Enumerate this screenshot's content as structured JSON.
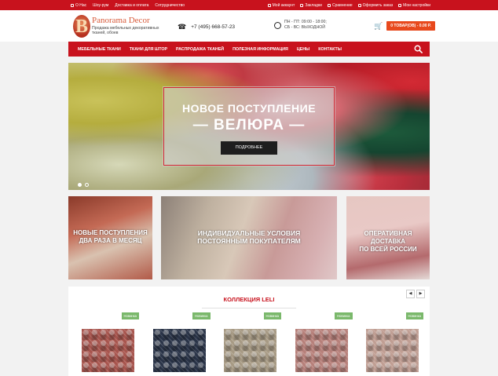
{
  "topbar": {
    "left": [
      "О Нас",
      "Шоу-рум",
      "Доставка и оплата",
      "Сотрудничество"
    ],
    "right": [
      "Мой аккаунт",
      "Закладки",
      "Сравнение",
      "Оформить заказ",
      "Мои настройки"
    ]
  },
  "header": {
    "logo_letter": "B",
    "logo_name": "Panorama Decor",
    "logo_tagline": "Продажа мебельных декоративных тканей, обоев",
    "phone": "+7 (495) 668-57-23",
    "hours_line1": "ПН - ПТ: 09:00 - 18:00;",
    "hours_line2": "СБ - ВС: ВЫХОДНОЙ",
    "cart_label": "0 ТОВАР(ОВ) - 0.00 Р."
  },
  "nav": {
    "items": [
      "Мебельные ткани",
      "Ткани для штор",
      "Распродажа тканей",
      "Полезная информация",
      "Цены",
      "Контакты"
    ]
  },
  "hero": {
    "line1": "НОВОЕ ПОСТУПЛЕНИЕ",
    "line2": "— ВЕЛЮРА —",
    "button": "ПОДРОБНЕЕ"
  },
  "promos": [
    {
      "line1": "НОВЫЕ ПОСТУПЛЕНИЯ",
      "line2": "ДВА РАЗА В МЕСЯЦ"
    },
    {
      "line1": "ИНДИВИДУАЛЬНЫЕ УСЛОВИЯ",
      "line2": "ПОСТОЯННЫМ ПОКУПАТЕЛЯМ"
    },
    {
      "line1": "ОПЕРАТИВНАЯ ДОСТАВКА",
      "line2": "ПО ВСЕЙ РОССИИ"
    }
  ],
  "collection": {
    "title": "КОЛЛЕКЦИЯ LELI",
    "prev": "◀",
    "next": "▶",
    "products": [
      {
        "badge": "Новинка",
        "color": "#a8554e"
      },
      {
        "badge": "Новинка",
        "color": "#2a3448"
      },
      {
        "badge": "Новинка",
        "color": "#a79a84"
      },
      {
        "badge": "Новинка",
        "color": "#b7807a"
      },
      {
        "badge": "Новинка",
        "color": "#c09e93"
      }
    ]
  }
}
